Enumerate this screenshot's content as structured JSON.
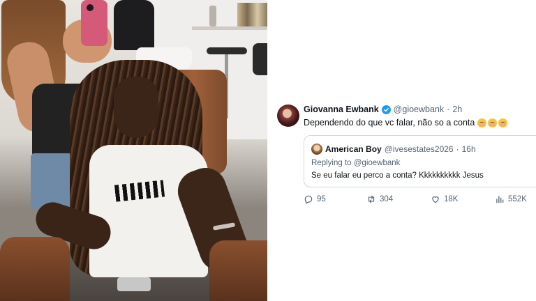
{
  "photo": {
    "description_icon": "photo-of-woman-taking-mirror-selfie-with-girl-in-salon-chair"
  },
  "tweet": {
    "author": {
      "name": "Giovanna Ewbank",
      "handle": "@gioewbank",
      "separator": "·",
      "time": "2h",
      "verified": true,
      "verified_color": "#1d9bf0"
    },
    "text": "Dependendo do que vc falar, não so a conta",
    "emojis": [
      "smiling-face-with-blush-icon",
      "smiling-face-with-blush-icon",
      "smiling-face-with-blush-icon"
    ],
    "quote": {
      "name": "American Boy",
      "handle": "@ivesestates2026",
      "separator": "·",
      "time": "16h",
      "replying_prefix": "Replying to",
      "replying_to": "@gioewbank",
      "text": "Se eu falar eu perco a conta? Kkkkkkkkkk Jesus"
    },
    "stats": {
      "replies": "95",
      "retweets": "304",
      "likes": "18K",
      "views": "552K"
    },
    "colors": {
      "text": "#0f1419",
      "secondary": "#536471",
      "border": "#cfd9de"
    }
  }
}
